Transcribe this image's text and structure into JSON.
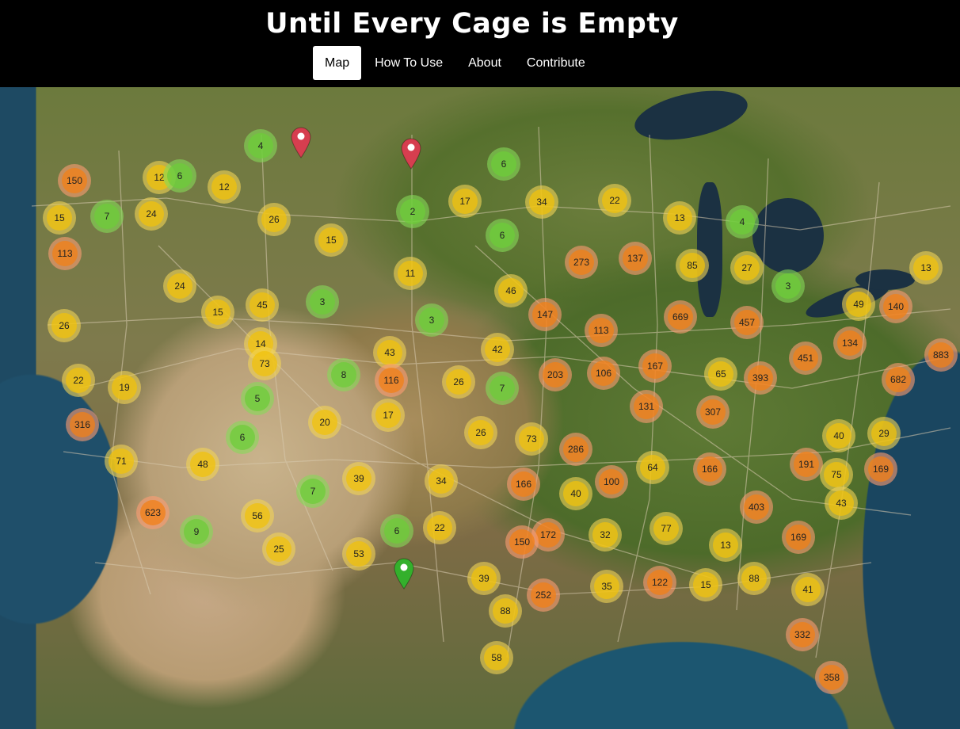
{
  "header": {
    "title": "Until Every Cage is Empty",
    "nav": [
      {
        "label": "Map",
        "active": true
      },
      {
        "label": "How To Use",
        "active": false
      },
      {
        "label": "About",
        "active": false
      },
      {
        "label": "Contribute",
        "active": false
      }
    ]
  },
  "map": {
    "cluster_colors": {
      "small": "#6ECC39",
      "medium": "#F0C20C",
      "large": "#F18017"
    },
    "pin_colors": {
      "red": "#D63E4F",
      "green": "#34B02C"
    },
    "clusters": [
      {
        "count": "4",
        "size": "small"
      },
      {
        "count": "150",
        "size": "large"
      },
      {
        "count": "12",
        "size": "medium"
      },
      {
        "count": "6",
        "size": "small"
      },
      {
        "count": "12",
        "size": "medium"
      },
      {
        "count": "6",
        "size": "small"
      },
      {
        "count": "15",
        "size": "medium"
      },
      {
        "count": "7",
        "size": "small"
      },
      {
        "count": "24",
        "size": "medium"
      },
      {
        "count": "26",
        "size": "medium"
      },
      {
        "count": "2",
        "size": "small"
      },
      {
        "count": "17",
        "size": "medium"
      },
      {
        "count": "34",
        "size": "medium"
      },
      {
        "count": "22",
        "size": "medium"
      },
      {
        "count": "13",
        "size": "medium"
      },
      {
        "count": "4",
        "size": "small"
      },
      {
        "count": "15",
        "size": "medium"
      },
      {
        "count": "6",
        "size": "small"
      },
      {
        "count": "113",
        "size": "large"
      },
      {
        "count": "273",
        "size": "large"
      },
      {
        "count": "137",
        "size": "large"
      },
      {
        "count": "85",
        "size": "medium"
      },
      {
        "count": "27",
        "size": "medium"
      },
      {
        "count": "13",
        "size": "medium"
      },
      {
        "count": "11",
        "size": "medium"
      },
      {
        "count": "24",
        "size": "medium"
      },
      {
        "count": "3",
        "size": "small"
      },
      {
        "count": "46",
        "size": "medium"
      },
      {
        "count": "3",
        "size": "small"
      },
      {
        "count": "15",
        "size": "medium"
      },
      {
        "count": "45",
        "size": "medium"
      },
      {
        "count": "49",
        "size": "medium"
      },
      {
        "count": "140",
        "size": "large"
      },
      {
        "count": "26",
        "size": "medium"
      },
      {
        "count": "147",
        "size": "large"
      },
      {
        "count": "3",
        "size": "small"
      },
      {
        "count": "113",
        "size": "large"
      },
      {
        "count": "669",
        "size": "large"
      },
      {
        "count": "457",
        "size": "large"
      },
      {
        "count": "14",
        "size": "medium"
      },
      {
        "count": "43",
        "size": "medium"
      },
      {
        "count": "42",
        "size": "medium"
      },
      {
        "count": "134",
        "size": "large"
      },
      {
        "count": "883",
        "size": "large"
      },
      {
        "count": "73",
        "size": "medium"
      },
      {
        "count": "451",
        "size": "large"
      },
      {
        "count": "22",
        "size": "medium"
      },
      {
        "count": "8",
        "size": "small"
      },
      {
        "count": "116",
        "size": "large"
      },
      {
        "count": "203",
        "size": "large"
      },
      {
        "count": "106",
        "size": "large"
      },
      {
        "count": "167",
        "size": "large"
      },
      {
        "count": "65",
        "size": "medium"
      },
      {
        "count": "393",
        "size": "large"
      },
      {
        "count": "682",
        "size": "large"
      },
      {
        "count": "19",
        "size": "medium"
      },
      {
        "count": "26",
        "size": "medium"
      },
      {
        "count": "7",
        "size": "small"
      },
      {
        "count": "5",
        "size": "small"
      },
      {
        "count": "131",
        "size": "large"
      },
      {
        "count": "17",
        "size": "medium"
      },
      {
        "count": "307",
        "size": "large"
      },
      {
        "count": "316",
        "size": "large"
      },
      {
        "count": "20",
        "size": "medium"
      },
      {
        "count": "6",
        "size": "small"
      },
      {
        "count": "26",
        "size": "medium"
      },
      {
        "count": "73",
        "size": "medium"
      },
      {
        "count": "40",
        "size": "medium"
      },
      {
        "count": "29",
        "size": "medium"
      },
      {
        "count": "286",
        "size": "large"
      },
      {
        "count": "71",
        "size": "medium"
      },
      {
        "count": "48",
        "size": "medium"
      },
      {
        "count": "191",
        "size": "large"
      },
      {
        "count": "64",
        "size": "medium"
      },
      {
        "count": "166",
        "size": "large"
      },
      {
        "count": "169",
        "size": "large"
      },
      {
        "count": "39",
        "size": "medium"
      },
      {
        "count": "34",
        "size": "medium"
      },
      {
        "count": "166",
        "size": "large"
      },
      {
        "count": "100",
        "size": "large"
      },
      {
        "count": "75",
        "size": "medium"
      },
      {
        "count": "7",
        "size": "small"
      },
      {
        "count": "40",
        "size": "medium"
      },
      {
        "count": "43",
        "size": "medium"
      },
      {
        "count": "623",
        "size": "large"
      },
      {
        "count": "403",
        "size": "large"
      },
      {
        "count": "56",
        "size": "medium"
      },
      {
        "count": "9",
        "size": "small"
      },
      {
        "count": "6",
        "size": "small"
      },
      {
        "count": "22",
        "size": "medium"
      },
      {
        "count": "172",
        "size": "large"
      },
      {
        "count": "32",
        "size": "medium"
      },
      {
        "count": "77",
        "size": "medium"
      },
      {
        "count": "169",
        "size": "large"
      },
      {
        "count": "150",
        "size": "large"
      },
      {
        "count": "13",
        "size": "medium"
      },
      {
        "count": "25",
        "size": "medium"
      },
      {
        "count": "53",
        "size": "medium"
      },
      {
        "count": "39",
        "size": "medium"
      },
      {
        "count": "35",
        "size": "medium"
      },
      {
        "count": "122",
        "size": "large"
      },
      {
        "count": "15",
        "size": "medium"
      },
      {
        "count": "88",
        "size": "medium"
      },
      {
        "count": "41",
        "size": "medium"
      },
      {
        "count": "252",
        "size": "large"
      },
      {
        "count": "88",
        "size": "medium"
      },
      {
        "count": "332",
        "size": "large"
      },
      {
        "count": "58",
        "size": "medium"
      },
      {
        "count": "358",
        "size": "large"
      }
    ],
    "pins": [
      {
        "color": "red"
      },
      {
        "color": "red"
      },
      {
        "color": "green"
      }
    ]
  }
}
